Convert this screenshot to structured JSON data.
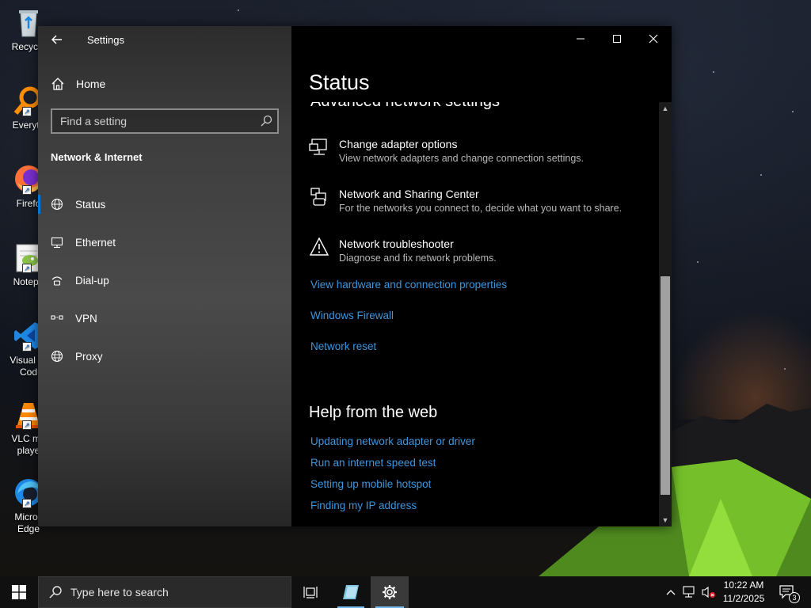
{
  "desktop": {
    "icons": [
      {
        "label": "Recycle",
        "icon": "recycle-bin-icon"
      },
      {
        "label": "Everyth",
        "icon": "everything-search-icon"
      },
      {
        "label": "Firefo",
        "icon": "firefox-icon"
      },
      {
        "label": "Notepa",
        "icon": "notepad-plus-plus-icon"
      },
      {
        "label": "Visual St\nCod",
        "icon": "vscode-icon"
      },
      {
        "label": "VLC me\nplaye",
        "icon": "vlc-icon"
      },
      {
        "label": "Micros\nEdge",
        "icon": "edge-icon"
      }
    ]
  },
  "window": {
    "app_title": "Settings",
    "controls": {
      "minimize": "minimize-icon",
      "maximize": "maximize-icon",
      "close": "close-icon"
    },
    "sidebar": {
      "home_label": "Home",
      "search_placeholder": "Find a setting",
      "section_heading": "Network & Internet",
      "items": [
        {
          "label": "Status",
          "icon": "globe-status-icon",
          "active": true
        },
        {
          "label": "Ethernet",
          "icon": "ethernet-icon",
          "active": false
        },
        {
          "label": "Dial-up",
          "icon": "dial-up-icon",
          "active": false
        },
        {
          "label": "VPN",
          "icon": "vpn-icon",
          "active": false
        },
        {
          "label": "Proxy",
          "icon": "proxy-globe-icon",
          "active": false
        }
      ]
    },
    "main": {
      "page_title": "Status",
      "cut_heading": "Advanced network settings",
      "options": [
        {
          "title": "Change adapter options",
          "desc": "View network adapters and change connection settings.",
          "icon": "adapter-icon"
        },
        {
          "title": "Network and Sharing Center",
          "desc": "For the networks you connect to, decide what you want to share.",
          "icon": "sharing-center-icon"
        },
        {
          "title": "Network troubleshooter",
          "desc": "Diagnose and fix network problems.",
          "icon": "warning-icon"
        }
      ],
      "links": [
        "View hardware and connection properties",
        "Windows Firewall",
        "Network reset"
      ],
      "help_heading": "Help from the web",
      "help_links": [
        "Updating network adapter or driver",
        "Run an internet speed test",
        "Setting up mobile hotspot",
        "Finding my IP address"
      ]
    }
  },
  "taskbar": {
    "search_placeholder": "Type here to search",
    "time": "10:22 AM",
    "date": "11/2/2025",
    "notification_count": "3"
  },
  "colors": {
    "accent": "#0078d7",
    "link": "#3a96e0"
  }
}
